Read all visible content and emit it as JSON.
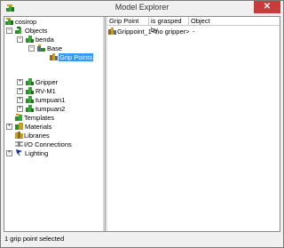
{
  "window": {
    "title": "Model Explorer",
    "close_glyph": "✕"
  },
  "tree": {
    "items": [
      {
        "label": "cosirop",
        "icon": "robot-cell-icon",
        "expander": ""
      },
      {
        "label": "Objects",
        "icon": "objects-icon",
        "expander": "−"
      },
      {
        "label": "benda",
        "icon": "object-icon",
        "expander": "−"
      },
      {
        "label": "Base",
        "icon": "base-icon",
        "expander": "−"
      },
      {
        "label": "Grip Points",
        "icon": "grip-points-icon",
        "expander": ""
      },
      {
        "label": "Gripper",
        "icon": "object-icon",
        "expander": "+"
      },
      {
        "label": "RV-M1",
        "icon": "object-icon",
        "expander": "+"
      },
      {
        "label": "tumpuan1",
        "icon": "object-icon",
        "expander": "+"
      },
      {
        "label": "tumpuan2",
        "icon": "object-icon",
        "expander": "+"
      },
      {
        "label": "Templates",
        "icon": "templates-icon",
        "expander": ""
      },
      {
        "label": "Materials",
        "icon": "materials-icon",
        "expander": "+"
      },
      {
        "label": "Libraries",
        "icon": "libraries-icon",
        "expander": ""
      },
      {
        "label": "I/O Connections",
        "icon": "io-connections-icon",
        "expander": ""
      },
      {
        "label": "Lighting",
        "icon": "lighting-icon",
        "expander": "+"
      }
    ]
  },
  "list": {
    "columns": [
      "Grip Point",
      "is grasped by",
      "Object"
    ],
    "rows": [
      {
        "grip_point": "Grippoint_1",
        "grasped_by": "<no gripper>",
        "object": "-"
      }
    ]
  },
  "status": {
    "text": "1 grip point selected"
  },
  "colors": {
    "selection": "#3399ff",
    "close_button": "#c83c3c",
    "icon_green": "#2e8b2e"
  }
}
